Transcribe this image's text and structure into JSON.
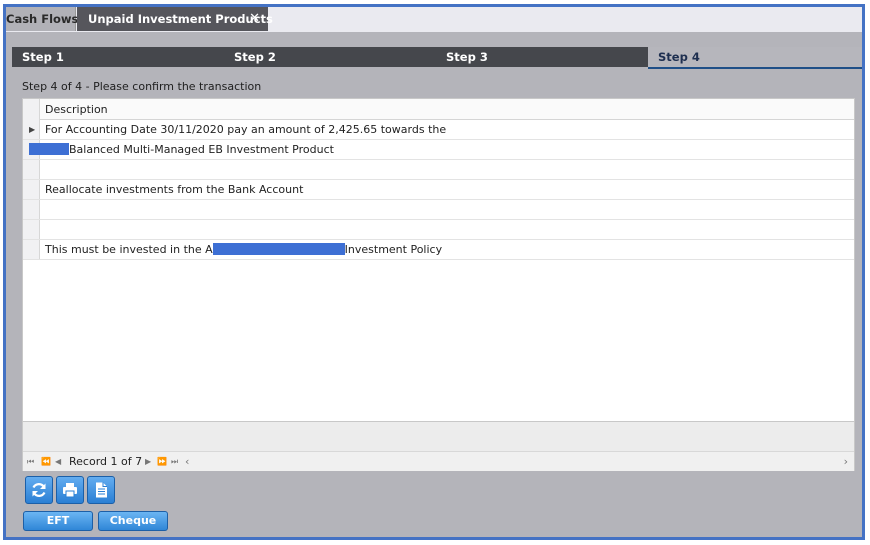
{
  "tabs": [
    {
      "label": "Cash Flows"
    },
    {
      "label": "Unpaid Investment Products",
      "close": "✕"
    }
  ],
  "steps": [
    "Step 1",
    "Step 2",
    "Step 3",
    "Step 4"
  ],
  "subtitle": "Step 4 of 4 - Please confirm the transaction",
  "grid": {
    "header": "Description",
    "rows": [
      {
        "pre": "For Accounting Date 30/11/2020 pay an amount of 2,425.65 towards the",
        "post": ""
      },
      {
        "pre": "",
        "post": "Balanced Multi-Managed EB Investment Product"
      },
      {
        "pre": "",
        "post": ""
      },
      {
        "pre": "Reallocate investments from the Bank Account",
        "post": ""
      },
      {
        "pre": "",
        "post": ""
      },
      {
        "pre": "",
        "post": ""
      },
      {
        "pre": "This must be invested in the A",
        "post": "Investment Policy"
      }
    ]
  },
  "pager": {
    "text": "Record 1 of 7"
  },
  "toolbar_icons": [
    "refresh-icon",
    "print-icon",
    "document-icon"
  ],
  "buttons": {
    "eft": "EFT",
    "cheque": "Cheque"
  },
  "colors": {
    "accent_border": "#4472c4",
    "button_blue": "#2f86d7",
    "redaction": "#3d6fd4",
    "active_step_underline": "#1f4f87"
  }
}
